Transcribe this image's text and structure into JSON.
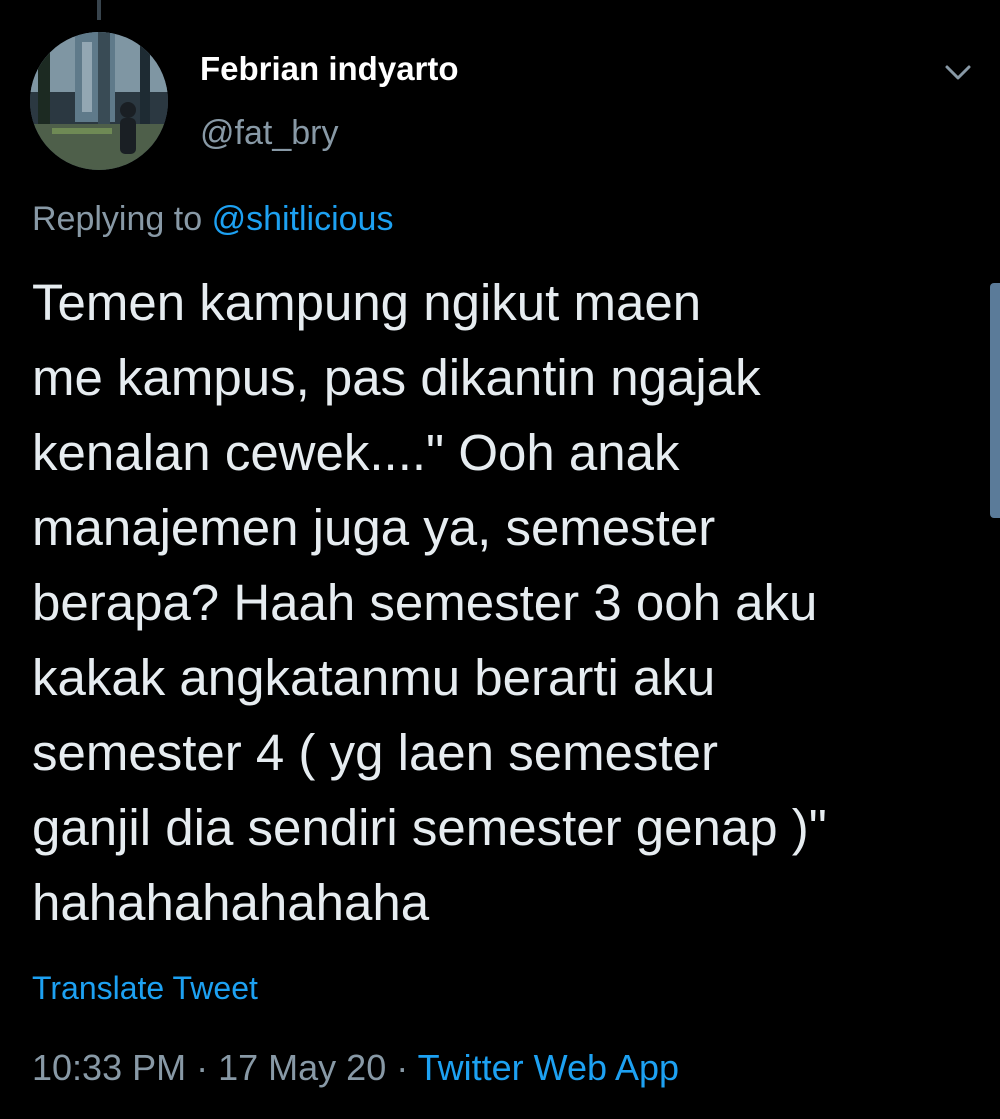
{
  "author": {
    "display_name": "Febrian indyarto",
    "handle": "@fat_bry"
  },
  "reply": {
    "prefix": "Replying to",
    "mention": "@shitlicious"
  },
  "tweet": {
    "lines": [
      "Temen kampung ngikut maen",
      "me kampus, pas dikantin ngajak",
      "kenalan cewek....\" Ooh anak",
      "manajemen juga ya, semester",
      "berapa? Haah semester 3 ooh aku",
      "kakak angkatanmu berarti aku",
      "semester 4 ( yg laen semester",
      "ganjil dia sendiri semester genap )\"",
      "hahahahahahaha"
    ]
  },
  "translate_label": "Translate Tweet",
  "meta": {
    "time": "10:33 PM",
    "separator": "·",
    "date": "17 May 20",
    "source": "Twitter Web App"
  },
  "icons": {
    "menu": "chevron-down-icon",
    "avatar": "profile-photo"
  },
  "colors": {
    "background": "#000000",
    "accent": "#1da1f2",
    "secondary_text": "#8899a6",
    "primary_text": "#e6ecf0"
  }
}
